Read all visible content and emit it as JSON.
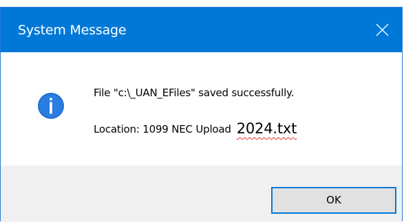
{
  "window": {
    "title": "System Message",
    "close_icon": "close-icon",
    "title_bar_color": "#0078d7"
  },
  "message": {
    "icon": "info-icon",
    "line1": "File \"c:\\_UAN_EFiles\" saved successfully.",
    "line2_prefix": "Location: 1099 NEC Upload",
    "line2_suffix": "2024.txt"
  },
  "buttons": {
    "ok_label": "OK"
  }
}
